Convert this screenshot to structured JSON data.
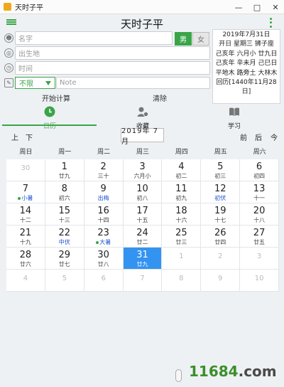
{
  "window": {
    "title": "天时子平",
    "minimize": "—",
    "maximize": "□",
    "close": "✕"
  },
  "header": {
    "title": "天时子平"
  },
  "form": {
    "name_placeholder": "名字",
    "gender": {
      "male": "男",
      "female": "女"
    },
    "birthplace_placeholder": "出生地",
    "time_placeholder": "时间",
    "category": "不限",
    "note_placeholder": "Note",
    "calc_label": "开始计算",
    "clear_label": "清除"
  },
  "info": {
    "lines": [
      "2019年7月31日",
      "开日 星期三 狮子座",
      "己亥年 六月小 廿九日",
      "己亥年 辛未月 己巳日",
      "平地木 路旁土 大林木",
      "回历[1440年11月28日]"
    ]
  },
  "tabs": [
    {
      "label": "日历"
    },
    {
      "label": "收藏"
    },
    {
      "label": "学习"
    }
  ],
  "nav": {
    "prev_year": "上",
    "next_year": "下",
    "month": "2019年 7 月",
    "prev_month": "前",
    "next_month": "后",
    "today": "今"
  },
  "calendar": {
    "weekdays": [
      "周日",
      "周一",
      "周二",
      "周三",
      "周四",
      "周五",
      "周六"
    ],
    "selected": "31",
    "days": [
      {
        "n": "30",
        "l": "",
        "other": true
      },
      {
        "n": "1",
        "l": "廿九"
      },
      {
        "n": "2",
        "l": "三十"
      },
      {
        "n": "3",
        "l": "六月小"
      },
      {
        "n": "4",
        "l": "初二"
      },
      {
        "n": "5",
        "l": "初三"
      },
      {
        "n": "6",
        "l": "初四"
      },
      {
        "n": "7",
        "l": "小暑",
        "term": true
      },
      {
        "n": "8",
        "l": "初六"
      },
      {
        "n": "9",
        "l": "出梅",
        "festival": true
      },
      {
        "n": "10",
        "l": "初八"
      },
      {
        "n": "11",
        "l": "初九"
      },
      {
        "n": "12",
        "l": "初伏",
        "festival": true
      },
      {
        "n": "13",
        "l": "十一"
      },
      {
        "n": "14",
        "l": "十二"
      },
      {
        "n": "15",
        "l": "十三"
      },
      {
        "n": "16",
        "l": "十四"
      },
      {
        "n": "17",
        "l": "十五"
      },
      {
        "n": "18",
        "l": "十六"
      },
      {
        "n": "19",
        "l": "十七"
      },
      {
        "n": "20",
        "l": "十八"
      },
      {
        "n": "21",
        "l": "十九"
      },
      {
        "n": "22",
        "l": "中伏",
        "festival": true
      },
      {
        "n": "23",
        "l": "大暑",
        "term": true
      },
      {
        "n": "24",
        "l": "廿二"
      },
      {
        "n": "25",
        "l": "廿三"
      },
      {
        "n": "26",
        "l": "廿四"
      },
      {
        "n": "27",
        "l": "廿五"
      },
      {
        "n": "28",
        "l": "廿六"
      },
      {
        "n": "29",
        "l": "廿七"
      },
      {
        "n": "30",
        "l": "廿八"
      },
      {
        "n": "31",
        "l": "廿九",
        "selected": true
      },
      {
        "n": "1",
        "l": "",
        "other": true
      },
      {
        "n": "2",
        "l": "",
        "other": true
      },
      {
        "n": "3",
        "l": "",
        "other": true
      },
      {
        "n": "4",
        "l": "",
        "other": true
      },
      {
        "n": "5",
        "l": "",
        "other": true
      },
      {
        "n": "6",
        "l": "",
        "other": true
      },
      {
        "n": "7",
        "l": "",
        "other": true
      },
      {
        "n": "8",
        "l": "",
        "other": true
      },
      {
        "n": "9",
        "l": "",
        "other": true
      },
      {
        "n": "10",
        "l": "",
        "other": true
      }
    ]
  },
  "watermark": {
    "brand": "11684",
    "suffix": ".com"
  },
  "colors": {
    "accent": "#3aa548",
    "selected": "#3393f1",
    "festival": "#1a4fd0"
  }
}
